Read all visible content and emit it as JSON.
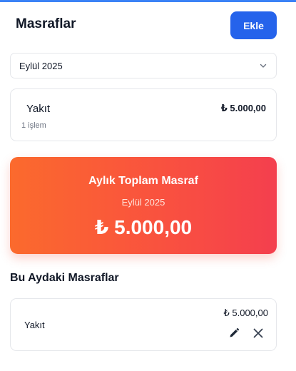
{
  "header": {
    "title": "Masraflar",
    "add_label": "Ekle"
  },
  "filter": {
    "selected_month": "Eylül 2025",
    "icon": "chevron-down-icon"
  },
  "category_summary": [
    {
      "name": "Yakıt",
      "amount": "₺ 5.000,00",
      "count": "1 işlem"
    }
  ],
  "total": {
    "title": "Aylık Toplam Masraf",
    "month": "Eylül 2025",
    "amount": "₺ 5.000,00",
    "gradient_colors": [
      "#fb6a2d",
      "#f43f4e"
    ]
  },
  "expenses_section": {
    "title": "Bu Aydaki Masraflar",
    "items": [
      {
        "name": "Yakıt",
        "amount": "₺ 5.000,00",
        "edit_icon": "pencil-icon",
        "delete_icon": "close-icon"
      }
    ]
  },
  "colors": {
    "accent": "#2563eb",
    "top_bar": "#3b82f6"
  }
}
